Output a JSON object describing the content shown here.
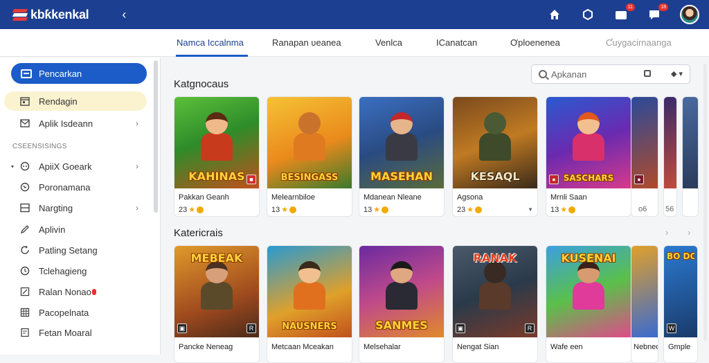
{
  "app": {
    "logo_text": "kbƙkenkal"
  },
  "header": {
    "back_icon": "chevron-left-icon",
    "notif_badge": "11",
    "messages_badge": "18"
  },
  "tabs": [
    {
      "label": "Namca Iccalnma",
      "active": true
    },
    {
      "label": "Ranapan ʋeanea",
      "active": false
    },
    {
      "label": "Venlca",
      "active": false
    },
    {
      "label": "ICanatcan",
      "active": false
    },
    {
      "label": "Ơploenenea",
      "active": false
    },
    {
      "label": "Ƈuygacirnaanga",
      "active": false
    }
  ],
  "sidebar": {
    "primary_button": "Pencarkan",
    "items_top": [
      {
        "label": "Rendagin",
        "icon": "calendar-icon"
      },
      {
        "label": "Aplik Isdeann",
        "icon": "mail-icon"
      }
    ],
    "section_label": "CSEENSISINGS",
    "items": [
      {
        "label": "ApiiX Goeark",
        "icon": "gamepad-icon"
      },
      {
        "label": "Poronamana",
        "icon": "compass-icon"
      },
      {
        "label": "Nargting",
        "icon": "layout-icon"
      },
      {
        "label": "Aplivin",
        "icon": "pen-icon"
      },
      {
        "label": "Patling Setang",
        "icon": "refresh-icon"
      },
      {
        "label": "Tclehagieng",
        "icon": "clock-icon"
      },
      {
        "label": "Ralan Nonao",
        "icon": "edit-icon"
      },
      {
        "label": "Pacopelnata",
        "icon": "grid-icon"
      },
      {
        "label": "Fetan Moaral",
        "icon": "document-icon"
      }
    ]
  },
  "search": {
    "placeholder": "Apkanan"
  },
  "sections": [
    {
      "heading": "Katgnocaus",
      "cards": [
        {
          "art_title": "KAHINAS",
          "name": "Pakkan Geanh",
          "rating": "23"
        },
        {
          "art_title": "BESINGASS",
          "name": "Melearnbiloe",
          "rating": "13"
        },
        {
          "art_title": "MASEHAN",
          "name": "Mdanean Nleane",
          "rating": "13"
        },
        {
          "art_title": "KESAQL",
          "name": "Agsona",
          "rating": "23"
        },
        {
          "art_title": "SASCHARS",
          "name": "Mrnli Saan",
          "rating": "13"
        },
        {
          "art_title": "",
          "name": "",
          "rating": "o6"
        },
        {
          "art_title": "",
          "name": "",
          "rating": "56"
        }
      ]
    },
    {
      "heading": "Katericrais",
      "cards": [
        {
          "art_title": "MEBEAK",
          "name": "Pancke Neneag",
          "rating": ""
        },
        {
          "art_title": "NAUSNERS",
          "name": "Metcaan Mceakan",
          "rating": ""
        },
        {
          "art_title": "SANMES",
          "name": "Melsehalar",
          "rating": ""
        },
        {
          "art_title": "RANAK",
          "name": "Nengat Sian",
          "rating": ""
        },
        {
          "art_title": "KUSENAI",
          "name": "Wafe een",
          "rating": ""
        },
        {
          "art_title": "",
          "name": "Nebneds",
          "rating": ""
        },
        {
          "art_title": "BO DO",
          "name": "Gmple",
          "rating": ""
        }
      ]
    }
  ],
  "colors": {
    "brand": "#1c3f91",
    "accent": "#1c5cc8",
    "highlight": "#fbf3d0",
    "badge": "#e5312f"
  }
}
